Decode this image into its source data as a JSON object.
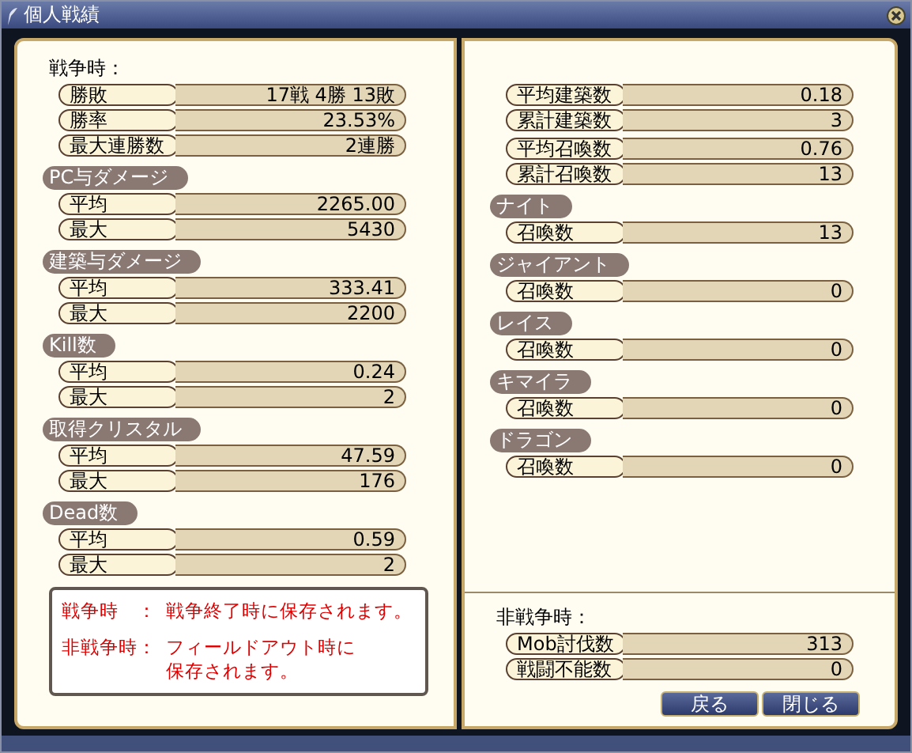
{
  "window": {
    "title": "個人戦績"
  },
  "left": {
    "heading": "戦争時：",
    "groups": [
      {
        "rows": [
          {
            "label": "勝敗",
            "value": "17戦 4勝 13敗"
          },
          {
            "label": "勝率",
            "value": "23.53%"
          },
          {
            "label": "最大連勝数",
            "value": "2連勝"
          }
        ]
      },
      {
        "title": "PC与ダメージ",
        "rows": [
          {
            "label": "平均",
            "value": "2265.00"
          },
          {
            "label": "最大",
            "value": "5430"
          }
        ]
      },
      {
        "title": "建築与ダメージ",
        "rows": [
          {
            "label": "平均",
            "value": "333.41"
          },
          {
            "label": "最大",
            "value": "2200"
          }
        ]
      },
      {
        "title": "Kill数",
        "rows": [
          {
            "label": "平均",
            "value": "0.24"
          },
          {
            "label": "最大",
            "value": "2"
          }
        ]
      },
      {
        "title": "取得クリスタル",
        "rows": [
          {
            "label": "平均",
            "value": "47.59"
          },
          {
            "label": "最大",
            "value": "176"
          }
        ]
      },
      {
        "title": "Dead数",
        "rows": [
          {
            "label": "平均",
            "value": "0.59"
          },
          {
            "label": "最大",
            "value": "2"
          }
        ]
      }
    ],
    "note": [
      {
        "term": "戦争時　：",
        "lines": [
          "戦争終了時に保存されます。"
        ]
      },
      {
        "term": "非戦争時：",
        "lines": [
          "フィールドアウト時に",
          "保存されます。"
        ]
      }
    ]
  },
  "right": {
    "groups": [
      {
        "rows": [
          {
            "label": "平均建築数",
            "value": "0.18"
          },
          {
            "label": "累計建築数",
            "value": "3"
          }
        ]
      },
      {
        "rows": [
          {
            "label": "平均召喚数",
            "value": "0.76"
          },
          {
            "label": "累計召喚数",
            "value": "13"
          }
        ]
      },
      {
        "title": "ナイト",
        "rows": [
          {
            "label": "召喚数",
            "value": "13"
          }
        ]
      },
      {
        "title": "ジャイアント",
        "rows": [
          {
            "label": "召喚数",
            "value": "0"
          }
        ]
      },
      {
        "title": "レイス",
        "rows": [
          {
            "label": "召喚数",
            "value": "0"
          }
        ]
      },
      {
        "title": "キマイラ",
        "rows": [
          {
            "label": "召喚数",
            "value": "0"
          }
        ]
      },
      {
        "title": "ドラゴン",
        "rows": [
          {
            "label": "召喚数",
            "value": "0"
          }
        ]
      }
    ],
    "section": {
      "heading": "非戦争時：",
      "rows": [
        {
          "label": "Mob討伐数",
          "value": "313"
        },
        {
          "label": "戦闘不能数",
          "value": "0"
        }
      ]
    }
  },
  "buttons": [
    "戻る",
    "閉じる"
  ]
}
